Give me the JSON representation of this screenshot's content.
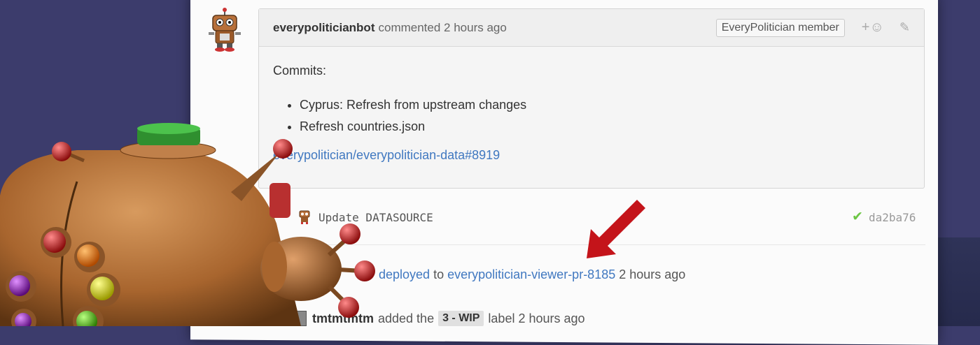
{
  "comment": {
    "author": "everypoliticianbot",
    "action": "commented 2 hours ago",
    "badge": "EveryPolitician member",
    "react_label": "+",
    "body_heading": "Commits:",
    "commits": [
      "Cyprus: Refresh from upstream changes",
      "Refresh countries.json"
    ],
    "link": "everypolitician/everypolitician-data#8919"
  },
  "commit": {
    "message": "Update DATASOURCE",
    "sha": "da2ba76",
    "status_icon": "check-icon"
  },
  "deploy": {
    "action": "deployed",
    "to_text": "to",
    "environment": "everypolitician-viewer-pr-8185",
    "time": "2 hours ago"
  },
  "label_event": {
    "actor": "tmtmtmtm",
    "action": "added the",
    "label": "3 - WIP",
    "suffix": "label 2 hours ago"
  },
  "colors": {
    "link": "#4078c0",
    "check": "#6cc644",
    "arrow": "#c4141a",
    "background": "#3c3c6c"
  }
}
